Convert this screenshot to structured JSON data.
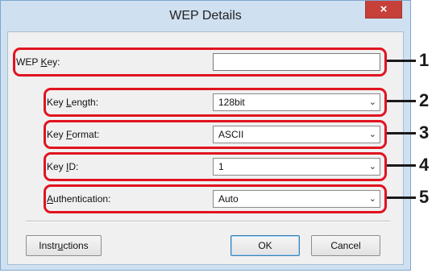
{
  "window": {
    "title": "WEP Details",
    "close_glyph": "×"
  },
  "fields": {
    "wep_key": {
      "label_pre": "WEP ",
      "label_accel": "K",
      "label_post": "ey:",
      "value": ""
    },
    "key_length": {
      "label_pre": "Key ",
      "label_accel": "L",
      "label_post": "ength:",
      "value": "128bit"
    },
    "key_format": {
      "label_pre": "Key ",
      "label_accel": "F",
      "label_post": "ormat:",
      "value": "ASCII"
    },
    "key_id": {
      "label_pre": "Key ",
      "label_accel": "I",
      "label_post": "D:",
      "value": "1"
    },
    "authentication": {
      "label_pre": "",
      "label_accel": "A",
      "label_post": "uthentication:",
      "value": "Auto"
    }
  },
  "buttons": {
    "instructions_pre": "Instr",
    "instructions_accel": "u",
    "instructions_post": "ctions",
    "ok": "OK",
    "cancel": "Cancel"
  },
  "callouts": [
    "1",
    "2",
    "3",
    "4",
    "5"
  ],
  "chevron_glyph": "⌄",
  "colors": {
    "highlight": "#e0141f",
    "titlebar": "#cfe0f1",
    "close": "#c7403a"
  }
}
